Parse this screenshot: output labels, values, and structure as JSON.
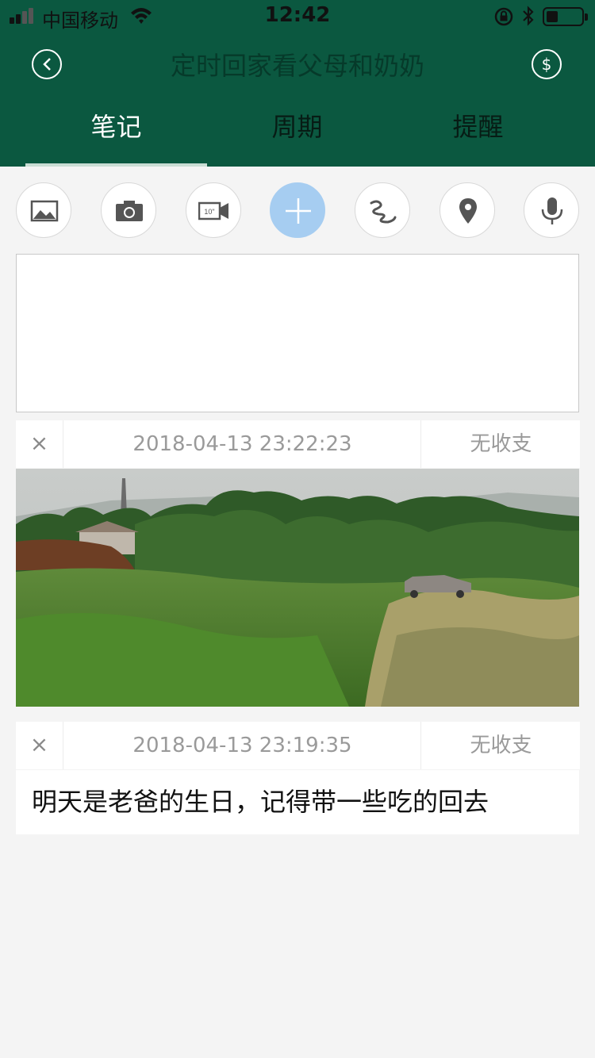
{
  "status_bar": {
    "carrier": "中国移动",
    "time": "12:42",
    "battery_level": 0.3
  },
  "header": {
    "title": "定时回家看父母和奶奶",
    "money_symbol": "$"
  },
  "tabs": [
    {
      "label": "笔记",
      "active": true
    },
    {
      "label": "周期",
      "active": false
    },
    {
      "label": "提醒",
      "active": false
    }
  ],
  "toolbar": {
    "icons": [
      "image-icon",
      "camera-icon",
      "video-icon",
      "plus-icon",
      "scribble-icon",
      "location-pin-icon",
      "microphone-icon"
    ],
    "video_label": "10\""
  },
  "note_input": {
    "value": ""
  },
  "entries": [
    {
      "close": "×",
      "datetime": "2018-04-13 23:22:23",
      "amount": "无收支",
      "type": "photo"
    },
    {
      "close": "×",
      "datetime": "2018-04-13 23:19:35",
      "amount": "无收支",
      "type": "text",
      "text": "明天是老爸的生日，记得带一些吃的回去"
    }
  ],
  "colors": {
    "header_bg": "#0b5840",
    "plus_button": "#a6cdf1",
    "page_bg": "#f4f4f4"
  }
}
